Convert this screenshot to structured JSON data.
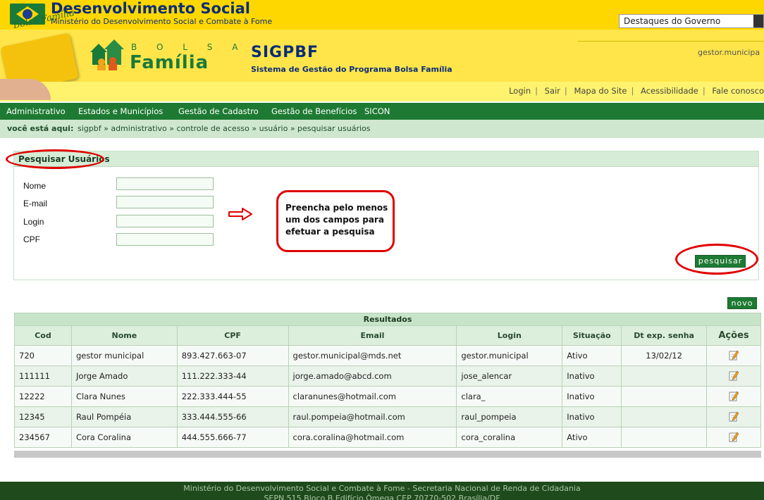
{
  "gov": {
    "title": "Desenvolvimento Social",
    "subtitle": "Ministério do Desenvolvimento Social e Combate à Fome",
    "destaques": "Destaques do Governo"
  },
  "banner": {
    "card_label": "Bolsa Família",
    "bolsa": "B O L S A",
    "familia": "Família",
    "sig_title": "SIGPBF",
    "sig_subtitle": "Sistema de Gestão do Programa Bolsa Família",
    "user": "gestor.municipa"
  },
  "links": [
    "Login",
    "Sair",
    "Mapa do Site",
    "Acessibilidade",
    "Fale conosco"
  ],
  "menu": [
    "Administrativo",
    "Estados e Municípios",
    "Gestão de Cadastro",
    "Gestão de Benefícios",
    "SICON"
  ],
  "breadcrumb": {
    "label": "você está aqui:",
    "path": "sigpbf » administrativo » controle de acesso » usuário » pesquisar usuários"
  },
  "search": {
    "title": "Pesquisar Usuários",
    "fields": [
      {
        "label": "Nome",
        "value": ""
      },
      {
        "label": "E-mail",
        "value": ""
      },
      {
        "label": "Login",
        "value": ""
      },
      {
        "label": "CPF",
        "value": ""
      }
    ],
    "callout": "Preencha pelo menos um dos campos para efetuar a pesquisa",
    "button": "pesquisar"
  },
  "new_button": "novo",
  "results": {
    "caption": "Resultados",
    "headers": [
      "Cod",
      "Nome",
      "CPF",
      "Email",
      "Login",
      "Situação",
      "Dt exp. senha",
      "Ações"
    ],
    "rows": [
      [
        "720",
        "gestor municipal",
        "893.427.663-07",
        "gestor.municipal@mds.net",
        "gestor.municipal",
        "Ativo",
        "13/02/12"
      ],
      [
        "111111",
        "Jorge Amado",
        "111.222.333-44",
        "jorge.amado@abcd.com",
        "jose_alencar",
        "Inativo",
        ""
      ],
      [
        "12222",
        "Clara Nunes",
        "222.333.444-55",
        "claranunes@hotmail.com",
        "clara_",
        "Inativo",
        ""
      ],
      [
        "12345",
        "Raul Pompéia",
        "333.444.555-66",
        "raul.pompeia@hotmail.com",
        "raul_pompeia",
        "Inativo",
        ""
      ],
      [
        "234567",
        "Cora Coralina",
        "444.555.666-77",
        "cora.coralina@hotmail.com",
        "cora_coralina",
        "Ativo",
        ""
      ]
    ]
  },
  "footer": {
    "line1": "Ministério do Desenvolvimento Social e Combate à Fome - Secretaria Nacional de Renda de Cidadania",
    "line2": "SEPN 515 Bloco B Edifício Ômega CEP 70770-502 Brasília/DF"
  },
  "colors": {
    "green": "#1e7a33",
    "yellow": "#ffd700",
    "red_annotation": "#e00000",
    "navy": "#0a2d78"
  },
  "icons": {
    "edit": "edit-icon",
    "arrow": "arrow-right-icon"
  }
}
